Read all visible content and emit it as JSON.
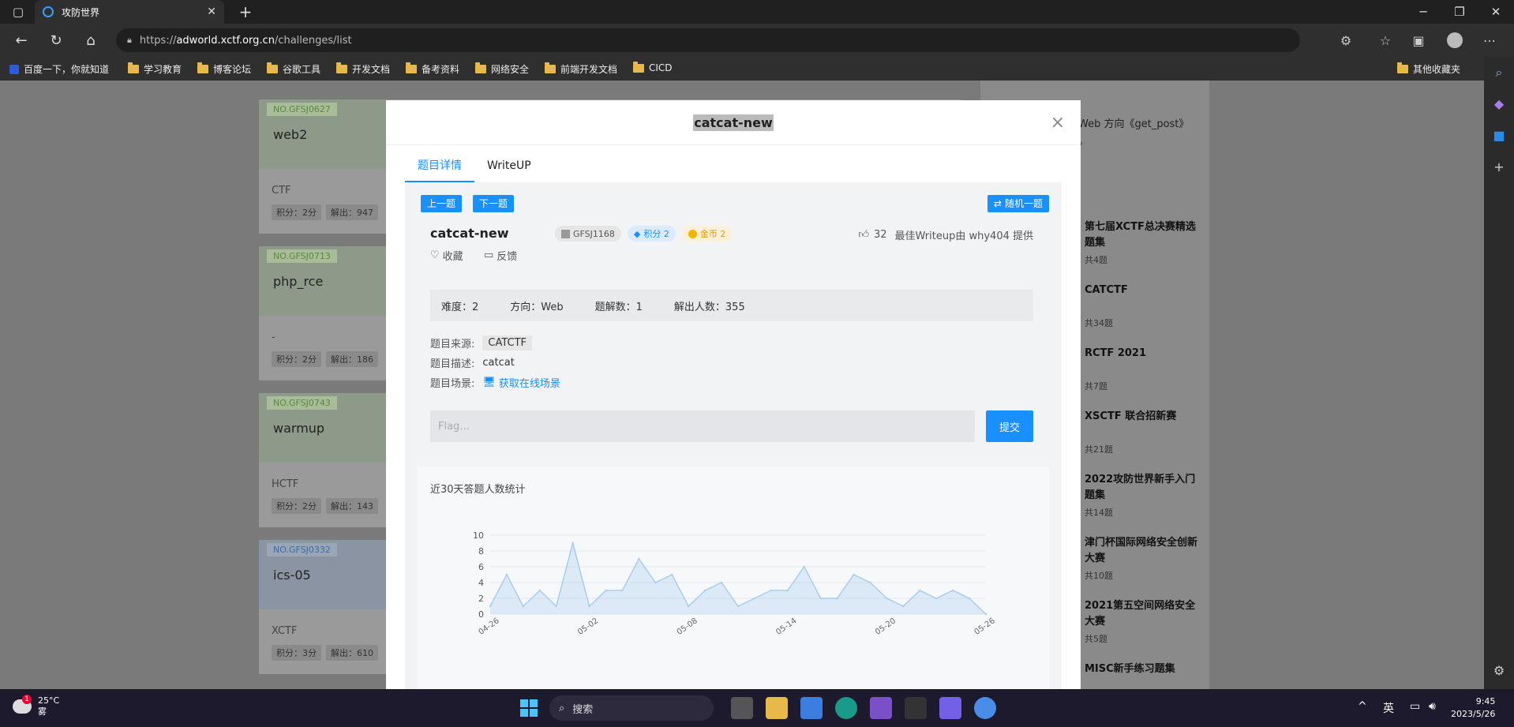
{
  "browser": {
    "tab_title": "攻防世界",
    "new_tab": "+",
    "url_prefix": "https://",
    "url_host": "adworld.xctf.org.cn",
    "url_path": "/challenges/list",
    "bookmarks": [
      "百度一下，你就知道",
      "学习教育",
      "博客论坛",
      "谷歌工具",
      "开发文档",
      "备考资料",
      "网络安全",
      "前端开发文档",
      "CICD"
    ],
    "other_bookmarks": "其他收藏夹"
  },
  "cards": [
    {
      "no": "NO.GFSJ0627",
      "name": "web2",
      "category": "CTF",
      "score": "积分：2分",
      "solved": "解出：947"
    },
    {
      "no": "NO.GFSJ0713",
      "name": "php_rce",
      "category": "-",
      "score": "积分：2分",
      "solved": "解出：186"
    },
    {
      "no": "NO.GFSJ0743",
      "name": "warmup",
      "category": "HCTF",
      "score": "积分：2分",
      "solved": "解出：143"
    },
    {
      "no": "NO.GFSJ0332",
      "name": "ics-05",
      "category": "XCTF",
      "score": "积分：3分",
      "solved": "解出：610"
    }
  ],
  "right_panel": {
    "top_text": "Web 方向《get_post》",
    "top_text2": "。",
    "items": [
      {
        "title": "第七届XCTF总决赛精选题集",
        "sub": "共4题"
      },
      {
        "title": "CATCTF",
        "sub": "共34题"
      },
      {
        "title": "RCTF 2021",
        "sub": "共7题"
      },
      {
        "title": "XSCTF 联合招新赛",
        "sub": "共21题"
      },
      {
        "title": "2022攻防世界新手入门题集",
        "sub": "共14题"
      },
      {
        "title": "津门杯国际网络安全创新大赛",
        "sub": "共10题"
      },
      {
        "title": "2021第五空间网络安全大赛",
        "sub": "共5题"
      },
      {
        "title": "MISC新手练习题集",
        "sub": ""
      }
    ]
  },
  "modal": {
    "title": "catcat-new",
    "close": "×",
    "tabs": [
      "题目详情",
      "WriteUP"
    ],
    "prev": "上一题",
    "next": "下一题",
    "random": "随机一题",
    "name": "catcat-new",
    "id_tag": "GFSJ1168",
    "score_tag": "积分 2",
    "coin_tag": "金币 2",
    "likes": "32",
    "writeup_by": "最佳Writeup由 why404 提供",
    "favorite": "收藏",
    "feedback": "反馈",
    "difficulty": "难度：2",
    "direction": "方向：Web",
    "writeups": "题解数：1",
    "solvers": "解出人数：355",
    "source_label": "题目来源:",
    "source_value": "CATCTF",
    "desc_label": "题目描述:",
    "desc_value": "catcat",
    "scene_label": "题目场景:",
    "scene_link": "获取在线场景",
    "flag_placeholder": "Flag...",
    "submit": "提交",
    "chart_title": "近30天答题人数统计"
  },
  "chart_data": {
    "type": "area",
    "title": "近30天答题人数统计",
    "x": [
      "04-26",
      "04-27",
      "04-28",
      "04-29",
      "04-30",
      "05-01",
      "05-02",
      "05-03",
      "05-04",
      "05-05",
      "05-06",
      "05-07",
      "05-08",
      "05-09",
      "05-10",
      "05-11",
      "05-12",
      "05-13",
      "05-14",
      "05-15",
      "05-16",
      "05-17",
      "05-18",
      "05-19",
      "05-20",
      "05-21",
      "05-22",
      "05-23",
      "05-24",
      "05-25",
      "05-26"
    ],
    "values": [
      1,
      5,
      1,
      3,
      1,
      9,
      1,
      3,
      3,
      7,
      4,
      5,
      1,
      3,
      4,
      1,
      2,
      3,
      3,
      6,
      2,
      2,
      5,
      4,
      2,
      1,
      3,
      2,
      3,
      2,
      0
    ],
    "xticks": [
      "04-26",
      "05-02",
      "05-08",
      "05-14",
      "05-20",
      "05-26"
    ],
    "yticks": [
      0,
      2,
      4,
      6,
      8,
      10
    ],
    "ylim": [
      0,
      10
    ],
    "color": "#a8cdf0"
  },
  "taskbar": {
    "weather_temp": "25°C",
    "weather_desc": "雾",
    "weather_badge": "1",
    "search": "搜索",
    "ime": "英",
    "time": "9:45",
    "date": "2023/5/26"
  },
  "colors": {
    "accent": "#1890ff",
    "chrome_dark": "#202020"
  }
}
